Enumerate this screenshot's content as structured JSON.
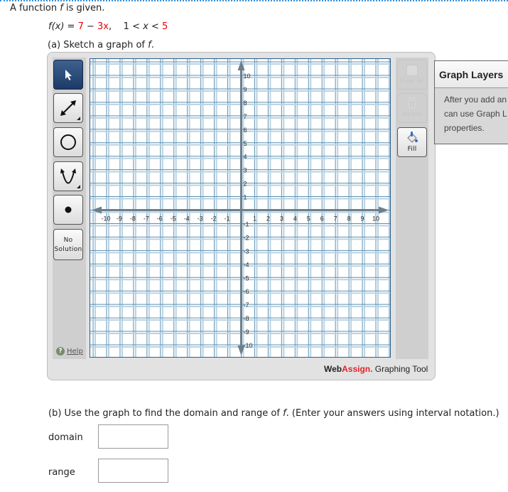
{
  "question": {
    "intro_prefix": "A function ",
    "intro_var": "f",
    "intro_suffix": " is given.",
    "function_lhs": "f(x) = ",
    "function_c1": "7",
    "function_minus": " − ",
    "function_c2": "3x",
    "function_comma": ",",
    "interval_left": "1 < ",
    "interval_var": "x",
    "interval_mid": " < ",
    "interval_right": "5",
    "part_a_prefix": "(a) Sketch a graph of ",
    "part_a_var": "f",
    "part_a_suffix": ".",
    "part_b_prefix": "(b) Use the graph to find the domain and range of ",
    "part_b_var": "f",
    "part_b_suffix": ". (Enter your answers using interval notation.)"
  },
  "graphing_tool": {
    "tools": [
      {
        "name": "select",
        "icon": "cursor-arrow-icon",
        "active": true
      },
      {
        "name": "line",
        "icon": "double-arrow-line-icon",
        "has_submenu": true
      },
      {
        "name": "circle",
        "icon": "circle-icon"
      },
      {
        "name": "parabola",
        "icon": "parabola-icon",
        "has_submenu": true
      },
      {
        "name": "point",
        "icon": "point-icon"
      }
    ],
    "no_solution_label_1": "No",
    "no_solution_label_2": "Solution",
    "help_label": "Help",
    "clear_all_label": "Clear All",
    "delete_label": "Delete",
    "fill_label": "Fill",
    "brand_web": "Web",
    "brand_assign": "Assign.",
    "brand_suffix": " Graphing Tool",
    "axes": {
      "x_min": -10,
      "x_max": 10,
      "y_min": -10,
      "y_max": 10,
      "x_ticks": [
        "-10",
        "-9",
        "-8",
        "-7",
        "-6",
        "-5",
        "-4",
        "-3",
        "-2",
        "-1",
        "1",
        "2",
        "3",
        "4",
        "5",
        "6",
        "7",
        "8",
        "9",
        "10"
      ],
      "y_ticks": [
        "10",
        "9",
        "8",
        "7",
        "6",
        "5",
        "4",
        "3",
        "2",
        "1",
        "-1",
        "-2",
        "-3",
        "-4",
        "-5",
        "-6",
        "-7",
        "-8",
        "-9",
        "-10"
      ]
    },
    "colors": {
      "grid_major": "#5b8fb0",
      "grid_minor": "#b9d3e3",
      "axis": "#6d7f8c",
      "active_tool": "#2a4a7a",
      "brand_red": "#e8202a"
    }
  },
  "graph_layers": {
    "title": "Graph Layers",
    "body_line_1": "After you add an",
    "body_line_2": "can use Graph L",
    "body_line_3": "properties."
  },
  "answers": {
    "domain_label": "domain",
    "domain_value": "",
    "range_label": "range",
    "range_value": ""
  }
}
